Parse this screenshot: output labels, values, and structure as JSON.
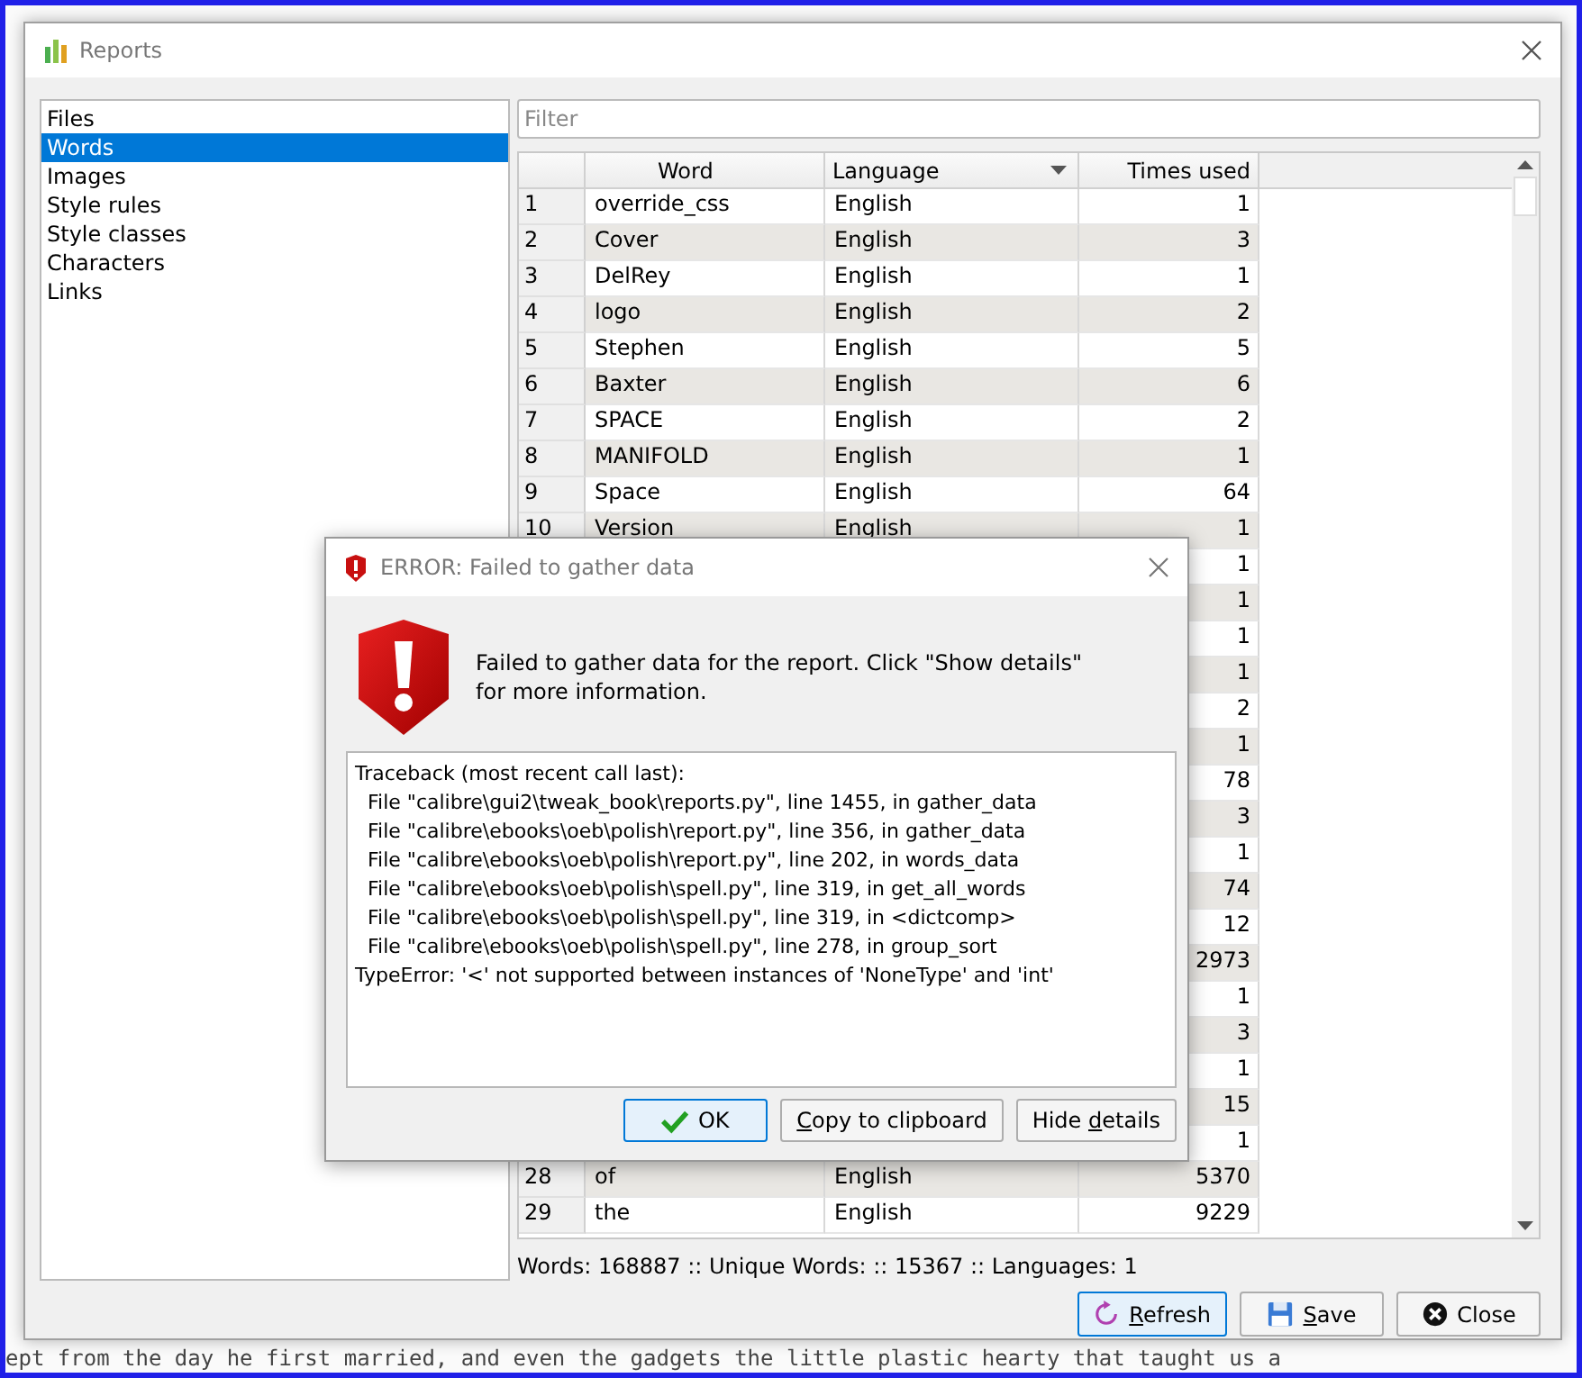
{
  "background_editor": {
    "bottom_line": "ept from the day he first married, and even the gadgets the little plastic hearty that taught us a"
  },
  "window": {
    "title": "Reports"
  },
  "sidebar": {
    "items": [
      {
        "label": "Files",
        "selected": false
      },
      {
        "label": "Words",
        "selected": true
      },
      {
        "label": "Images",
        "selected": false
      },
      {
        "label": "Style rules",
        "selected": false
      },
      {
        "label": "Style classes",
        "selected": false
      },
      {
        "label": "Characters",
        "selected": false
      },
      {
        "label": "Links",
        "selected": false
      }
    ]
  },
  "filter": {
    "placeholder": "Filter"
  },
  "table": {
    "columns": [
      {
        "label": "Word",
        "sorted": false
      },
      {
        "label": "Language",
        "sorted": true
      },
      {
        "label": "Times used",
        "sorted": false
      }
    ],
    "rows": [
      {
        "number": "1",
        "word": "override_css",
        "language": "English",
        "times_used": "1"
      },
      {
        "number": "2",
        "word": "Cover",
        "language": "English",
        "times_used": "3"
      },
      {
        "number": "3",
        "word": "DelRey",
        "language": "English",
        "times_used": "1"
      },
      {
        "number": "4",
        "word": "logo",
        "language": "English",
        "times_used": "2"
      },
      {
        "number": "5",
        "word": "Stephen",
        "language": "English",
        "times_used": "5"
      },
      {
        "number": "6",
        "word": "Baxter",
        "language": "English",
        "times_used": "6"
      },
      {
        "number": "7",
        "word": "SPACE",
        "language": "English",
        "times_used": "2"
      },
      {
        "number": "8",
        "word": "MANIFOLD",
        "language": "English",
        "times_used": "1"
      },
      {
        "number": "9",
        "word": "Space",
        "language": "English",
        "times_used": "64"
      },
      {
        "number": "10",
        "word": "Version",
        "language": "English",
        "times_used": "1"
      },
      {
        "times_used": "1"
      },
      {
        "times_used": "1"
      },
      {
        "times_used": "1"
      },
      {
        "times_used": "1"
      },
      {
        "times_used": "2"
      },
      {
        "times_used": "1"
      },
      {
        "times_used": "78"
      },
      {
        "times_used": "3"
      },
      {
        "times_used": "1"
      },
      {
        "times_used": "74"
      },
      {
        "times_used": "12"
      },
      {
        "times_used": "2973"
      },
      {
        "times_used": "1"
      },
      {
        "times_used": "3"
      },
      {
        "times_used": "1"
      },
      {
        "times_used": "15"
      },
      {
        "times_used": "1"
      },
      {
        "number": "28",
        "word": "of",
        "language": "English",
        "times_used": "5370"
      },
      {
        "number": "29",
        "word": "the",
        "language": "English",
        "times_used": "9229"
      }
    ]
  },
  "status_bar": "Words: 168887 :: Unique Words: :: 15367 :: Languages: 1",
  "buttons": [
    {
      "kind": "refresh",
      "label_parts": [
        {
          "text": "R",
          "underlined": true
        },
        {
          "text": "efresh",
          "underlined": false
        }
      ],
      "focused": true
    },
    {
      "kind": "save",
      "label_parts": [
        {
          "text": "S",
          "underlined": true
        },
        {
          "text": "ave",
          "underlined": false
        }
      ],
      "focused": false
    },
    {
      "kind": "close",
      "label": "Close",
      "focused": false
    }
  ],
  "error_dialog": {
    "title": "ERROR: Failed to gather data",
    "message": "Failed to gather data for the report. Click \"Show details\" for more information.",
    "details": [
      "Traceback (most recent call last):",
      "  File \"calibre\\gui2\\tweak_book\\reports.py\", line 1455, in gather_data",
      "  File \"calibre\\ebooks\\oeb\\polish\\report.py\", line 356, in gather_data",
      "  File \"calibre\\ebooks\\oeb\\polish\\report.py\", line 202, in words_data",
      "  File \"calibre\\ebooks\\oeb\\polish\\spell.py\", line 319, in get_all_words",
      "  File \"calibre\\ebooks\\oeb\\polish\\spell.py\", line 319, in <dictcomp>",
      "  File \"calibre\\ebooks\\oeb\\polish\\spell.py\", line 278, in group_sort",
      "TypeError: '<' not supported between instances of 'NoneType' and 'int'"
    ],
    "buttons": [
      {
        "kind": "ok",
        "label": "OK",
        "focused": true
      },
      {
        "kind": "copy",
        "label_parts": [
          {
            "text": "C",
            "underlined": true
          },
          {
            "text": "opy to clipboard",
            "underlined": false
          }
        ],
        "focused": false
      },
      {
        "kind": "details",
        "label_parts": [
          {
            "text": "Hide ",
            "underlined": false
          },
          {
            "text": "d",
            "underlined": true
          },
          {
            "text": "etails",
            "underlined": false
          }
        ],
        "focused": false
      }
    ]
  }
}
